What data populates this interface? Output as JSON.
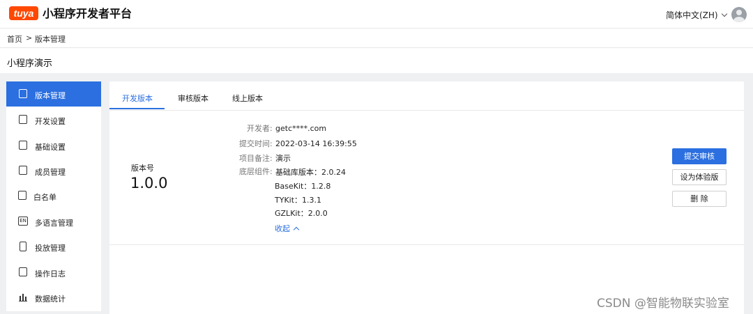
{
  "header": {
    "logo_text": "tuya",
    "title": "小程序开发者平台",
    "language": "简体中文(ZH)",
    "brand_color": "#ff4800"
  },
  "breadcrumb": {
    "home": "首页",
    "separator": ">",
    "current": "版本管理"
  },
  "page_title": "小程序演示",
  "sidebar": {
    "items": [
      {
        "label": "版本管理",
        "icon": "version-icon",
        "active": true
      },
      {
        "label": "开发设置",
        "icon": "dev-settings-icon"
      },
      {
        "label": "基础设置",
        "icon": "basic-settings-icon"
      },
      {
        "label": "成员管理",
        "icon": "members-icon"
      },
      {
        "label": "白名单",
        "icon": "whitelist-icon"
      },
      {
        "label": "多语言管理",
        "icon": "language-icon",
        "glyph": "EN"
      },
      {
        "label": "投放管理",
        "icon": "device-icon"
      },
      {
        "label": "操作日志",
        "icon": "log-icon"
      },
      {
        "label": "数据统计",
        "icon": "stats-icon"
      }
    ]
  },
  "tabs": [
    {
      "label": "开发版本",
      "active": true
    },
    {
      "label": "审核版本"
    },
    {
      "label": "线上版本"
    }
  ],
  "version": {
    "label": "版本号",
    "number": "1.0.0",
    "fields": [
      {
        "key": "开发者:",
        "value": "getc****.com"
      },
      {
        "key": "提交时间:",
        "value": "2022-03-14 16:39:55"
      },
      {
        "key": "项目备注:",
        "value": "演示"
      },
      {
        "key": "底层组件:",
        "value": "基础库版本：2.0.24"
      }
    ],
    "components": [
      "BaseKit：1.2.8",
      "TYKit：1.3.1",
      "GZLKit：2.0.0"
    ],
    "collapse_label": "收起"
  },
  "actions": {
    "submit_review": "提交审核",
    "set_experience": "设为体验版",
    "delete": "删 除"
  },
  "accent_color": "#2b6fe0",
  "watermark": "CSDN @智能物联实验室"
}
